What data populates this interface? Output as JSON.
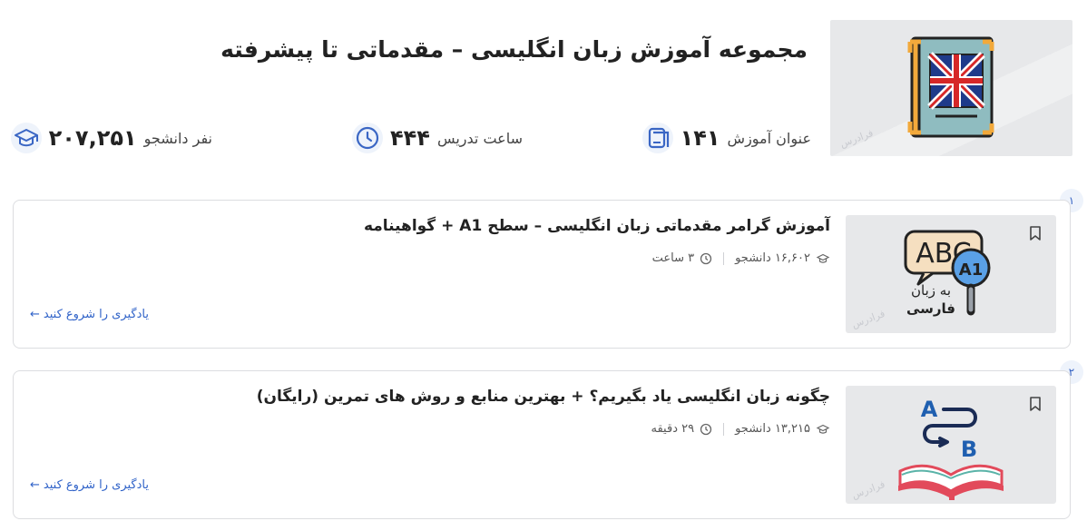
{
  "header": {
    "title": "مجموعه آموزش زبان انگلیسی – مقدماتی تا پیشرفته",
    "watermark": "فرادرس",
    "stats": {
      "courses": {
        "value": "۱۴۱",
        "label": "عنوان آموزش",
        "icon": "courses-icon"
      },
      "hours": {
        "value": "۴۴۴",
        "label": "ساعت تدریس",
        "icon": "clock-icon"
      },
      "students": {
        "value": "۲۰۷,۲۵۱",
        "label": "نفر دانشجو",
        "icon": "graduation-cap-icon"
      }
    }
  },
  "courses": [
    {
      "index": "۱",
      "title": "آموزش گرامر مقدماتی زبان انگلیسی – سطح A1 + گواهینامه",
      "students": "۱۶,۶۰۲ دانشجو",
      "duration": "۳ ساعت",
      "cta": "یادگیری را شروع کنید",
      "thumb": {
        "abc": "ABC",
        "level": "A1",
        "line1": "به زبان",
        "line2": "فارسی"
      }
    },
    {
      "index": "۲",
      "title": "چگونه زبان انگلیسی یاد بگیریم؟ + بهترین منابع و روش های تمرین (رایگان)",
      "students": "۱۳,۲۱۵ دانشجو",
      "duration": "۲۹ دقیقه",
      "cta": "یادگیری را شروع کنید",
      "thumb": {
        "a": "A",
        "b": "B"
      }
    }
  ],
  "colors": {
    "accent": "#3a66c4",
    "link": "#2f62c8",
    "border": "#dcdde0",
    "thumb_bg": "#e7e8ea"
  }
}
